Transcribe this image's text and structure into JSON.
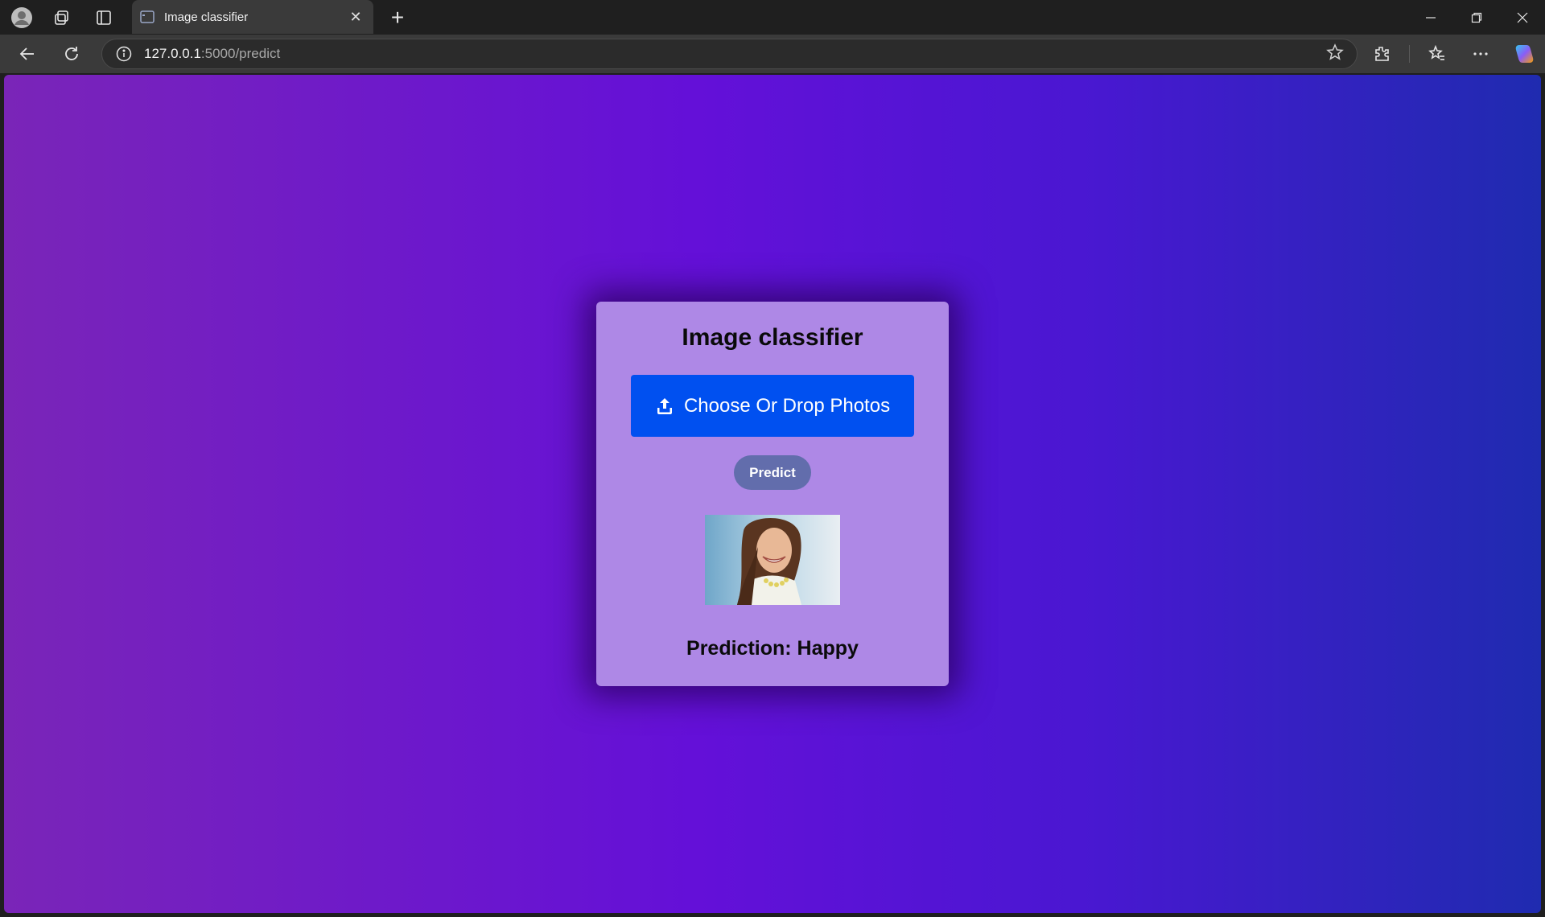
{
  "browser": {
    "tab_title": "Image classifier",
    "url_host": "127.0.0.1",
    "url_rest": ":5000/predict",
    "new_tab_label": "+",
    "tab_close_label": "✕"
  },
  "page": {
    "heading": "Image classifier",
    "upload_label": "Choose Or Drop Photos",
    "predict_label": "Predict",
    "prediction_text": "Prediction: Happy"
  },
  "colors": {
    "upload_button": "#0050f0",
    "predict_button": "#626dac",
    "card": "#ae88e6"
  },
  "icons": [
    "profile-icon",
    "workspaces-icon",
    "vertical-tabs-icon",
    "page-favicon",
    "back-icon",
    "refresh-icon",
    "info-icon",
    "favorite-star-icon",
    "extensions-icon",
    "favorites-icon",
    "more-icon",
    "copilot-icon",
    "upload-icon"
  ]
}
